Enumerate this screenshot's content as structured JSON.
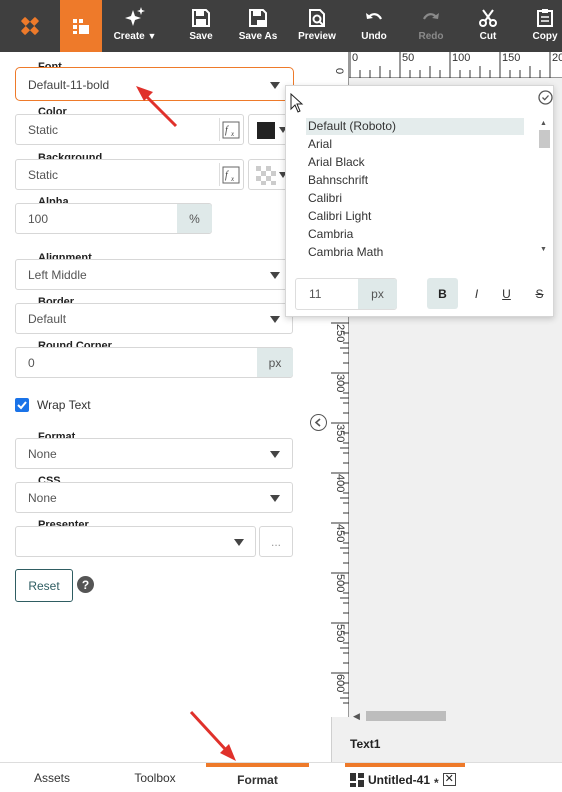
{
  "toolbar": {
    "create_label": "Create",
    "save_label": "Save",
    "saveas_label": "Save As",
    "preview_label": "Preview",
    "undo_label": "Undo",
    "redo_label": "Redo",
    "cut_label": "Cut",
    "copy_label": "Copy"
  },
  "colors": {
    "toolbar_bg": "#3f3f3f",
    "accent": "#ee7a2a",
    "arrow": "#e0312b",
    "unit_bg": "#dfe9e9"
  },
  "form": {
    "font_label": "Font",
    "font_value": "Default-11-bold",
    "color_label": "Color",
    "color_value": "Static",
    "color_swatch": "#222222",
    "background_label": "Background",
    "background_value": "Static",
    "alpha_label": "Alpha",
    "alpha_value": "100",
    "alpha_unit": "%",
    "alignment_label": "Alignment",
    "alignment_value": "Left Middle",
    "border_label": "Border",
    "border_value": "Default",
    "round_label": "Round Corner",
    "round_value": "0",
    "round_unit": "px",
    "wrap_label": "Wrap Text",
    "wrap_checked": true,
    "format_label": "Format",
    "format_value": "None",
    "css_label": "CSS",
    "css_value": "None",
    "presenter_label": "Presenter",
    "presenter_value": "",
    "presenter_more": "...",
    "reset_label": "Reset",
    "help_icon": "?"
  },
  "font_popup": {
    "options": [
      "Default (Roboto)",
      "Arial",
      "Arial Black",
      "Bahnschrift",
      "Calibri",
      "Calibri Light",
      "Cambria",
      "Cambria Math"
    ],
    "selected_index": 0,
    "size_value": "11",
    "size_unit": "px",
    "bold": "B",
    "italic": "I",
    "underline": "U",
    "strike": "S"
  },
  "ruler": {
    "h_ticks": [
      "0",
      "50",
      "100",
      "150",
      "20"
    ],
    "v_ticks": [
      "0",
      "250",
      "300",
      "350",
      "400",
      "450",
      "500",
      "550",
      "600"
    ]
  },
  "canvas": {
    "selected_element": "Text1"
  },
  "bottom": {
    "tabs": [
      "Assets",
      "Toolbox",
      "Format"
    ],
    "active_tab": 2,
    "document_name": "Untitled-41",
    "modified_marker": "*"
  }
}
